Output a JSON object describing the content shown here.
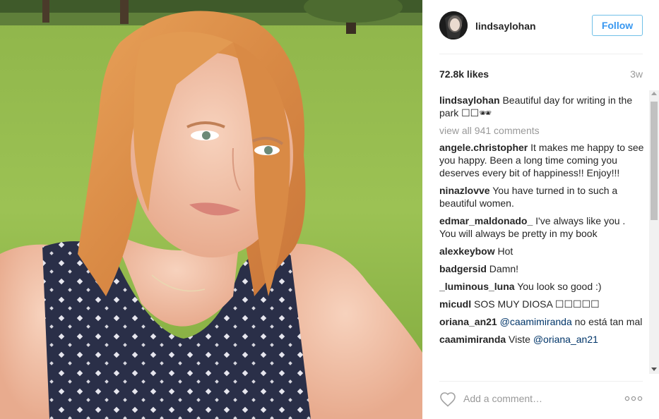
{
  "post": {
    "username": "lindsaylohan",
    "follow_label": "Follow",
    "likes": "72.8k likes",
    "time": "3w",
    "caption_user": "lindsaylohan",
    "caption_text": " Beautiful day for writing in the park ☐☐🕶",
    "view_all": "view all 941 comments",
    "add_comment_placeholder": "Add a comment…",
    "more_label": "ooo"
  },
  "comments": [
    {
      "user": "angele.christopher",
      "text": " It makes me happy to see you happy. Been a long time coming you deserves every bit of happiness!! Enjoy!!!"
    },
    {
      "user": "ninazlovve",
      "text": " You have turned in to such a beautiful women."
    },
    {
      "user": "edmar_maldonado_",
      "text": " I've always like you . You will always be pretty in my book"
    },
    {
      "user": "alexkeybow",
      "text": " Hot"
    },
    {
      "user": "badgersid",
      "text": " Damn!"
    },
    {
      "user": "_luminous_luna",
      "text": " You look so good :)"
    },
    {
      "user": "micudl",
      "text": " SOS MUY DIOSA ☐☐☐☐☐"
    },
    {
      "user": "oriana_an21",
      "mention": " @caamimiranda",
      "text": " no está tan mal"
    },
    {
      "user": "caamimiranda",
      "text": " Viste ",
      "mention": "@oriana_an21"
    }
  ],
  "icons": {
    "heart": "heart-outline-icon",
    "more": "more-options-icon",
    "avatar": "profile-avatar"
  },
  "colors": {
    "follow_text": "#3897f0",
    "follow_border": "#70c0e8",
    "secondary_text": "#999999",
    "mention": "#003569"
  }
}
